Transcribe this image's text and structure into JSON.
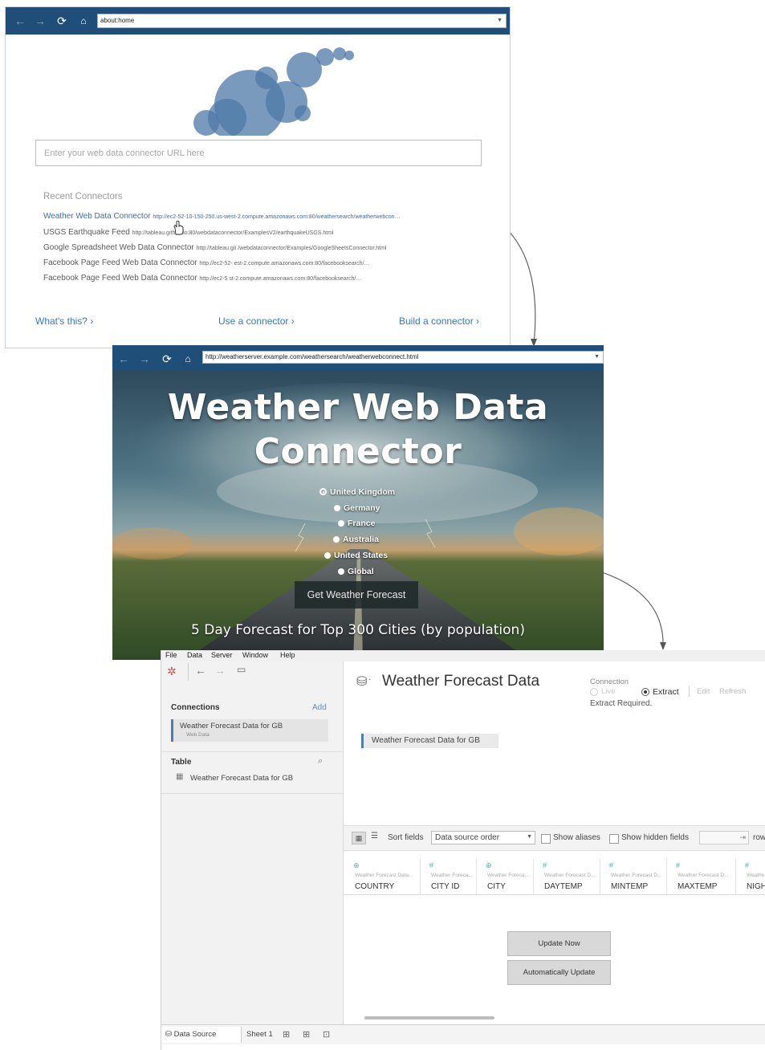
{
  "win1": {
    "url": "about:home",
    "input_placeholder": "Enter your web data connector URL here",
    "recent_title": "Recent Connectors",
    "recent": [
      {
        "name": "Weather Web Data Connector",
        "url": "http://ec2-52-10-150-250.us-west-2.compute.amazonaws.com:80/weathersearch/weatherwebcon…"
      },
      {
        "name": "USGS Earthquake Feed",
        "url": "http://tableau.github.io:80/webdataconnector/ExamplesV2/earthquakeUSGS.html"
      },
      {
        "name": "Google Spreadsheet Web Data Connector",
        "url": "http://tableau.git   /webdataconnector/Examples/GoogleSheetsConnector.html"
      },
      {
        "name": "Facebook Page Feed Web Data Connector",
        "url": "http://ec2-52-  est-2.compute.amazonaws.com:80/facebooksearch/…"
      },
      {
        "name": "Facebook Page Feed Web Data Connector",
        "url": "http://ec2-5  st-2.compute.amazonaws.com:80/facebooksearch/…"
      }
    ],
    "links": {
      "whats_this": "What's this? ›",
      "use_connector": "Use a connector ›",
      "build_connector": "Build a connector ›"
    }
  },
  "win2": {
    "url": "http://weatherserver.example.com/weathersearch/weatherwebconnect.html",
    "title_line1": "Weather Web Data",
    "title_line2": "Connector",
    "countries": [
      "United Kingdom",
      "Germany",
      "France",
      "Australia",
      "United States",
      "Global"
    ],
    "selected_country": "United Kingdom",
    "button": "Get Weather Forecast",
    "subtitle": "5 Day Forecast for Top 300 Cities (by population)"
  },
  "win3": {
    "menu": [
      "File",
      "Data",
      "Server",
      "Window",
      "Help"
    ],
    "connections_label": "Connections",
    "add_label": "Add",
    "connection_name": "Weather Forecast Data for GB",
    "connection_type": "Web Data",
    "table_label": "Table",
    "table_item": "Weather Forecast Data for GB",
    "ds_title": "Weather Forecast Data",
    "connection_caption": "Connection",
    "live_label": "Live",
    "extract_label": "Extract",
    "edit_label": "Edit",
    "refresh_label": "Refresh",
    "extract_required": "Extract Required.",
    "ds_tag": "Weather Forecast Data for GB",
    "sort_label": "Sort fields",
    "sort_value": "Data source order",
    "show_aliases": "Show aliases",
    "show_hidden": "Show hidden fields",
    "rows_label": "row",
    "columns": [
      {
        "src": "Weather Forecast Data...",
        "name": "COUNTRY"
      },
      {
        "src": "Weather Foreca...",
        "name": "CITY ID"
      },
      {
        "src": "Weather Foreca...",
        "name": "CITY"
      },
      {
        "src": "Weather Forecast D...",
        "name": "DAYTEMP"
      },
      {
        "src": "Weather Forecast D...",
        "name": "MINTEMP"
      },
      {
        "src": "Weather Forecast D...",
        "name": "MAXTEMP"
      },
      {
        "src": "Weathe",
        "name": "NIGH"
      }
    ],
    "update_now": "Update Now",
    "auto_update": "Automatically Update",
    "tab_datasource": "Data Source",
    "tab_sheet1": "Sheet 1"
  }
}
